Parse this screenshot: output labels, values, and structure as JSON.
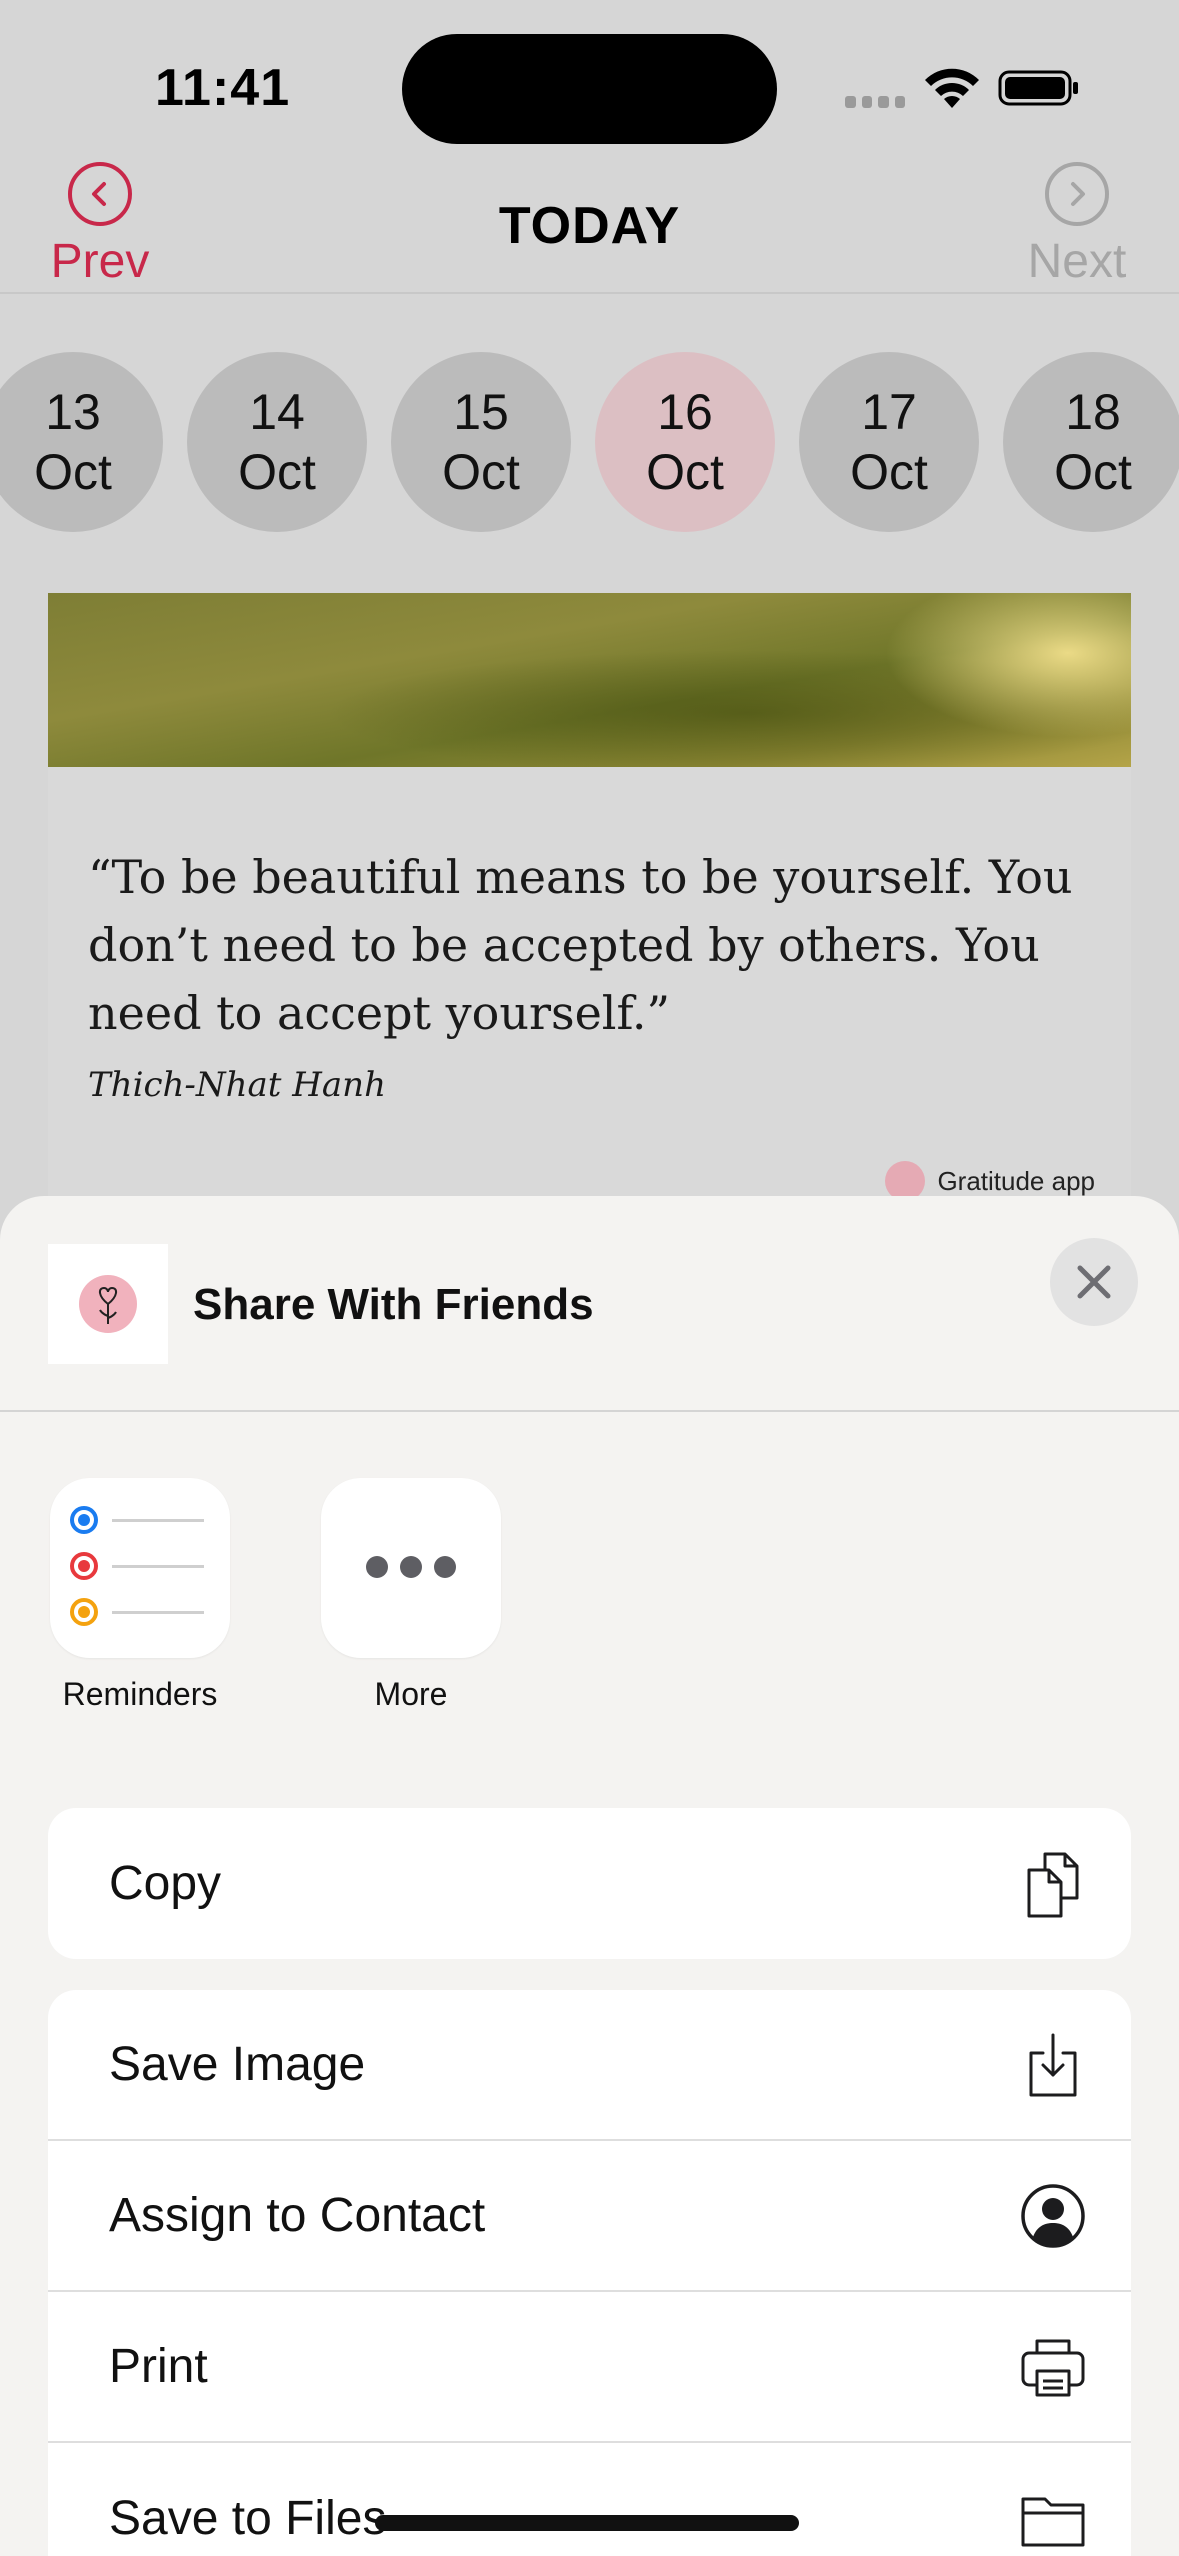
{
  "status_bar": {
    "time": "11:41"
  },
  "nav": {
    "prev_label": "Prev",
    "title": "TODAY",
    "next_label": "Next"
  },
  "dates": [
    {
      "day": "13",
      "month": "Oct",
      "selected": false
    },
    {
      "day": "14",
      "month": "Oct",
      "selected": false
    },
    {
      "day": "15",
      "month": "Oct",
      "selected": false
    },
    {
      "day": "16",
      "month": "Oct",
      "selected": true
    },
    {
      "day": "17",
      "month": "Oct",
      "selected": false
    },
    {
      "day": "18",
      "month": "Oct",
      "selected": false
    }
  ],
  "quote": {
    "text": "“To be beautiful means to be yourself. You don’t need to be accepted by others. You need to accept yourself.”",
    "author": "Thich-Nhat Hanh",
    "watermark": "Gratitude app"
  },
  "share_sheet": {
    "title": "Share With Friends",
    "apps": [
      {
        "label": "Reminders",
        "icon": "reminders-icon"
      },
      {
        "label": "More",
        "icon": "more-icon"
      }
    ],
    "actions_group1": [
      {
        "label": "Copy",
        "icon": "copy-icon"
      }
    ],
    "actions_group2": [
      {
        "label": "Save Image",
        "icon": "save-image-icon"
      },
      {
        "label": "Assign to Contact",
        "icon": "contact-icon"
      },
      {
        "label": "Print",
        "icon": "print-icon"
      },
      {
        "label": "Save to Files",
        "icon": "folder-icon"
      }
    ]
  },
  "colors": {
    "accent": "#c8284a",
    "selected_date": "#dcbfc3",
    "reminder_blue": "#1a7cf0",
    "reminder_red": "#e8393d",
    "reminder_orange": "#f4a20f"
  }
}
